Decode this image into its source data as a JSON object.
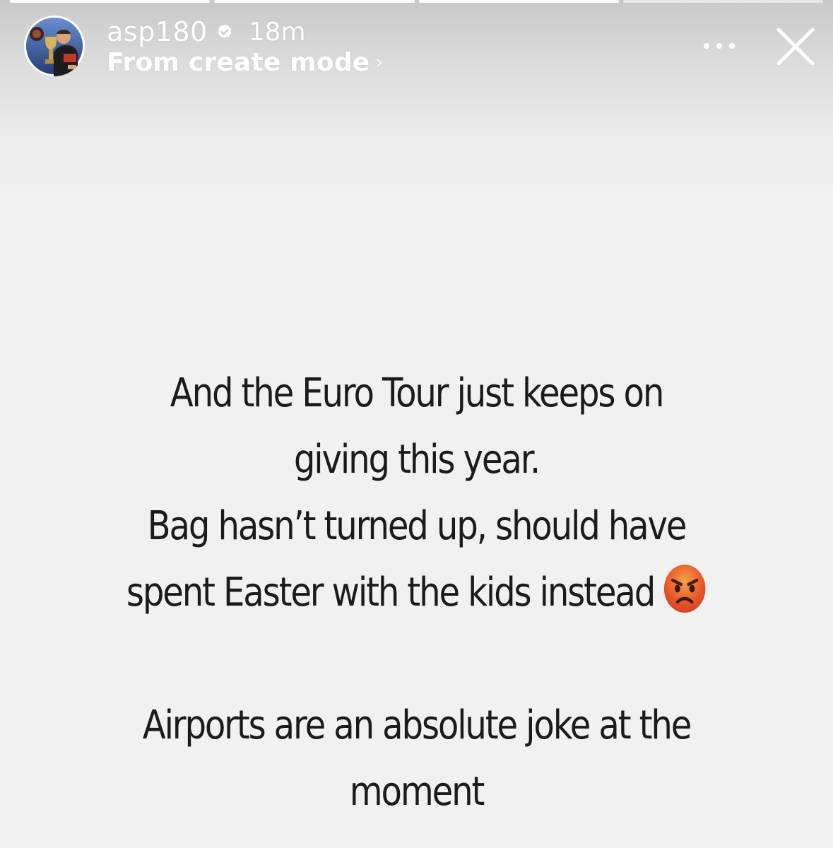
{
  "story_header": {
    "username": "asp180",
    "verified_icon": "verified-badge-icon",
    "time_ago": "18m",
    "mode_label": "From create mode",
    "mode_chevron_icon": "chevron-right-icon",
    "more_icon": "more-options-icon",
    "close_icon": "close-icon"
  },
  "progress": {
    "segments": 4
  },
  "story": {
    "background_color": "#f1f1f1",
    "text_color": "#1b1b1b",
    "lines": [
      "And the Euro Tour just keeps on",
      "giving this year.",
      "Bag hasn’t turned up, should have",
      "spent Easter with the kids instead",
      "",
      "Airports are an absolute joke at the",
      "moment"
    ],
    "emoji_icon": "angry-face-emoji"
  }
}
